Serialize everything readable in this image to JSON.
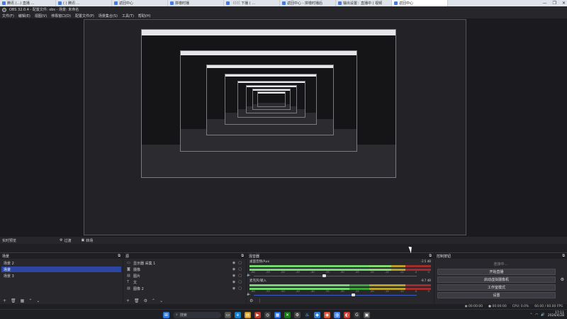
{
  "browser_tabs": [
    {
      "label": "腾讯 (...) 直播 …"
    },
    {
      "label": "( ( 腾讯 …"
    },
    {
      "label": "返回中心"
    },
    {
      "label": "拼缴时播"
    },
    {
      "label": "〈〈〈〈 下播 ( …"
    },
    {
      "label": "返回中心 - 拼缴时播后"
    },
    {
      "label": "输出设置：直播中 ( 视频"
    },
    {
      "label": "返回中心"
    }
  ],
  "window_controls": [
    "—",
    "❐",
    "✕"
  ],
  "titlebar": {
    "text": "OBS 32.0.4 - 配置文件: obs - 场景: 未命名"
  },
  "menu": [
    "文件(F)",
    "编辑(E)",
    "视图(V)",
    "停靠窗口(D)",
    "配置文件(P)",
    "场景集合(S)",
    "工具(T)",
    "帮助(H)"
  ],
  "scenebar": {
    "left_label": "实时预览",
    "btn1": "过渡",
    "btn2": "转场"
  },
  "scenes_dock": {
    "title": "场景",
    "items": [
      "场景 2",
      "场景",
      "场景 3"
    ],
    "selected_index": 1
  },
  "sources_dock": {
    "title": "源",
    "items": [
      {
        "icon": "display-icon",
        "label": "显示器 采集 1"
      },
      {
        "icon": "camera-icon",
        "label": "摄像"
      },
      {
        "icon": "image-icon",
        "label": "图片"
      },
      {
        "icon": "text-icon",
        "label": "文"
      },
      {
        "icon": "image-icon",
        "label": "图像 2"
      }
    ]
  },
  "mixer_dock": {
    "title": "混音器",
    "tracks": [
      {
        "name": "桌面音频/Aux",
        "db": "-2.5 dB",
        "level": 0.78,
        "fader": 0.42
      },
      {
        "name": "麦克风/输入",
        "db": "-8.7 dB",
        "level": 0.55,
        "fader": 0.6
      }
    ],
    "ticks": [
      "-60",
      "-55",
      "-50",
      "-45",
      "-40",
      "-35",
      "-30",
      "-25",
      "-20",
      "-15",
      "-10",
      "-5",
      "0"
    ]
  },
  "controls_dock": {
    "title": "控制按钮",
    "status": "连接中…",
    "buttons": [
      "开始直播",
      "启动虚拟摄像机",
      "工作室模式",
      "设置"
    ]
  },
  "statusbar": {
    "stream_time": "00:00:00",
    "rec_time": "00:00:00",
    "cpu": "CPU: 0.0%",
    "fps": "60.00 / 60.00 FPS"
  },
  "taskbar": {
    "search_placeholder": "搜索",
    "time": "17:11",
    "date": "2026/4/28"
  },
  "colors": {
    "selection": "#2d46a3",
    "meter_green": "#3aa33a",
    "meter_yellow": "#b7a02a",
    "meter_red": "#a22b2b",
    "fader_track": "#3b5bc4"
  }
}
